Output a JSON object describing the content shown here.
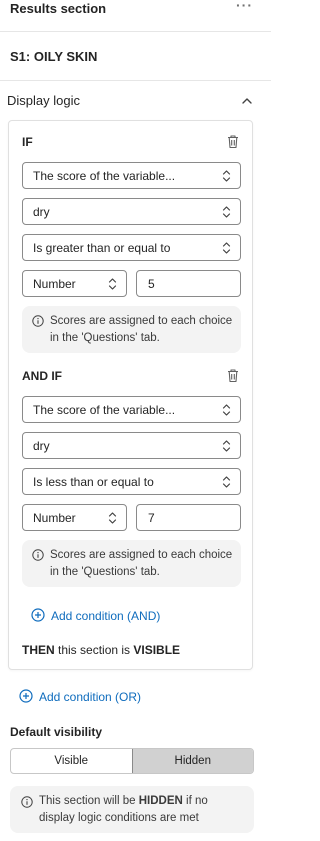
{
  "header": {
    "title": "Results section",
    "more_icon": "more-horizontal-icon"
  },
  "section": {
    "name": "S1: OILY SKIN"
  },
  "display_logic": {
    "label": "Display logic",
    "blocks": [
      {
        "keyword": "IF",
        "subject": "The score of the variable...",
        "variable": "dry",
        "operator": "Is greater than or equal to",
        "value_type": "Number",
        "value": "5",
        "note_line1": "Scores are assigned to each choice",
        "note_line2": "in the 'Questions' tab."
      },
      {
        "keyword": "AND IF",
        "subject": "The score of the variable...",
        "variable": "dry",
        "operator": "Is less than or equal to",
        "value_type": "Number",
        "value": "7",
        "note_line1": "Scores are assigned to each choice",
        "note_line2": "in the 'Questions' tab."
      }
    ],
    "add_and": "Add condition (AND)",
    "then_keyword": "THEN",
    "then_text": " this section is ",
    "then_state": "VISIBLE",
    "add_or": "Add condition (OR)"
  },
  "default_visibility": {
    "label": "Default visibility",
    "options": [
      "Visible",
      "Hidden"
    ],
    "selected": "Hidden",
    "note_pre": "This section will be ",
    "note_bold": "HIDDEN",
    "note_post": " if no",
    "note_line2": "display logic conditions are met"
  },
  "colors": {
    "accent": "#0f6cbd",
    "border": "#8a8a8a",
    "note_bg": "#f3f3f3",
    "toggle_on": "#d1d1d1"
  }
}
